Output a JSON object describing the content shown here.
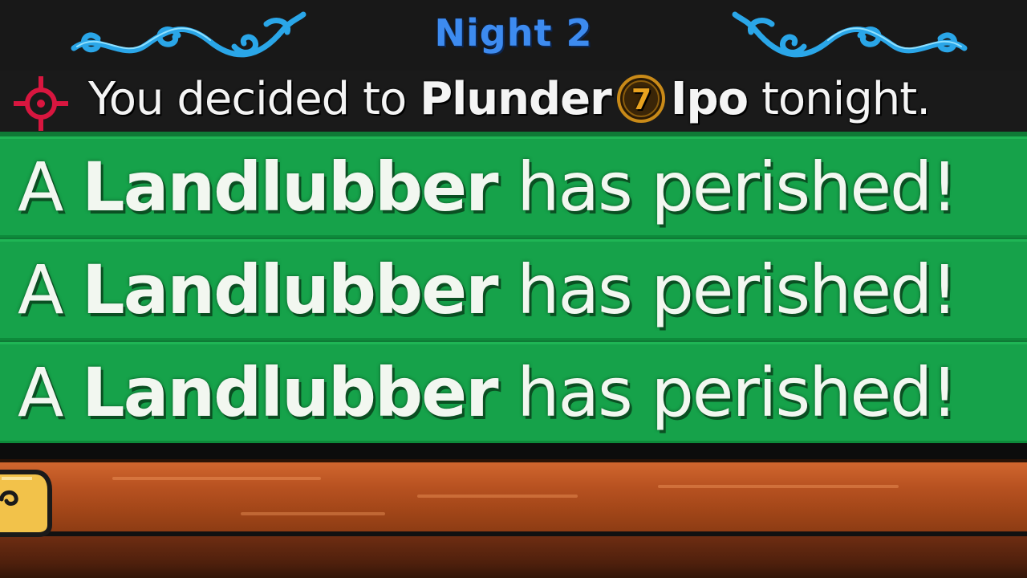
{
  "header": {
    "night_word": "Night",
    "night_number": "2",
    "title_color": "#3d8bf0",
    "ornament": "blue-swirl-flourish"
  },
  "decision": {
    "icon": "crosshair-target-icon",
    "prefix": "You decided to",
    "action": "Plunder",
    "player_number": "7",
    "target_name": "Ipo",
    "suffix": "tonight."
  },
  "announcements": [
    {
      "article": "A",
      "role": "Landlubber",
      "message": "has perished!"
    },
    {
      "article": "A",
      "role": "Landlubber",
      "message": "has perished!"
    },
    {
      "article": "A",
      "role": "Landlubber",
      "message": "has perished!"
    }
  ],
  "colors": {
    "banner_green": "#16a24a",
    "wood": "#b85221"
  }
}
